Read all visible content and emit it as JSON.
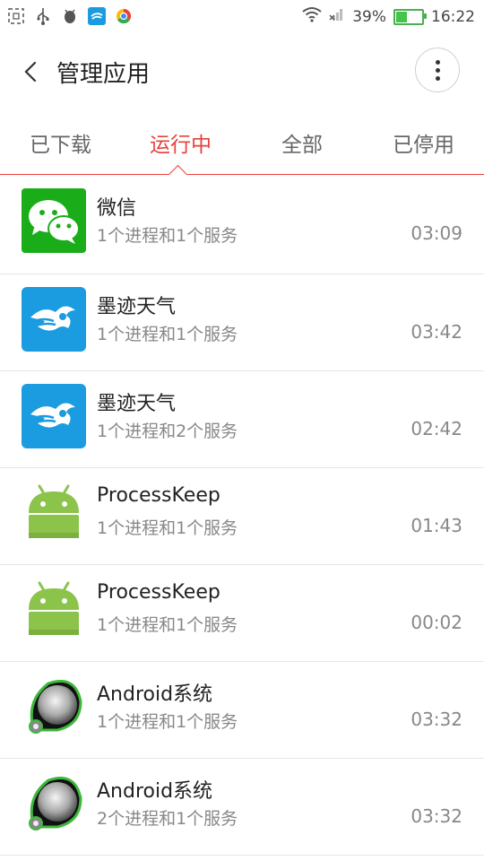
{
  "status_bar": {
    "battery_percent": "39%",
    "battery_level": 0.39,
    "time": "16:22",
    "left_icons": [
      "screenshot-icon",
      "usb-icon",
      "android-debug-icon",
      "weather-notification-icon",
      "browser-notification-icon"
    ],
    "right_icons": [
      "wifi-icon",
      "signal-icon"
    ]
  },
  "header": {
    "title": "管理应用"
  },
  "tabs": [
    {
      "label": "已下载",
      "active": false
    },
    {
      "label": "运行中",
      "active": true
    },
    {
      "label": "全部",
      "active": false
    },
    {
      "label": "已停用",
      "active": false
    }
  ],
  "apps": [
    {
      "name": "微信",
      "detail": "1个进程和1个服务",
      "time": "03:09",
      "icon": "wechat-icon"
    },
    {
      "name": "墨迹天气",
      "detail": "1个进程和1个服务",
      "time": "03:42",
      "icon": "moji-weather-icon"
    },
    {
      "name": "墨迹天气",
      "detail": "1个进程和2个服务",
      "time": "02:42",
      "icon": "moji-weather-icon"
    },
    {
      "name": "ProcessKeep",
      "detail": "1个进程和1个服务",
      "time": "01:43",
      "icon": "android-icon"
    },
    {
      "name": "ProcessKeep",
      "detail": "1个进程和1个服务",
      "time": "00:02",
      "icon": "android-icon"
    },
    {
      "name": "Android系统",
      "detail": "1个进程和1个服务",
      "time": "03:32",
      "icon": "android-system-icon"
    },
    {
      "name": "Android系统",
      "detail": "2个进程和1个服务",
      "time": "03:32",
      "icon": "android-system-icon"
    }
  ],
  "colors": {
    "accent": "#e8413c",
    "wechat": "#1aad19",
    "moji": "#1b9be0",
    "android": "#8cc34b",
    "battery": "#43c44a"
  }
}
